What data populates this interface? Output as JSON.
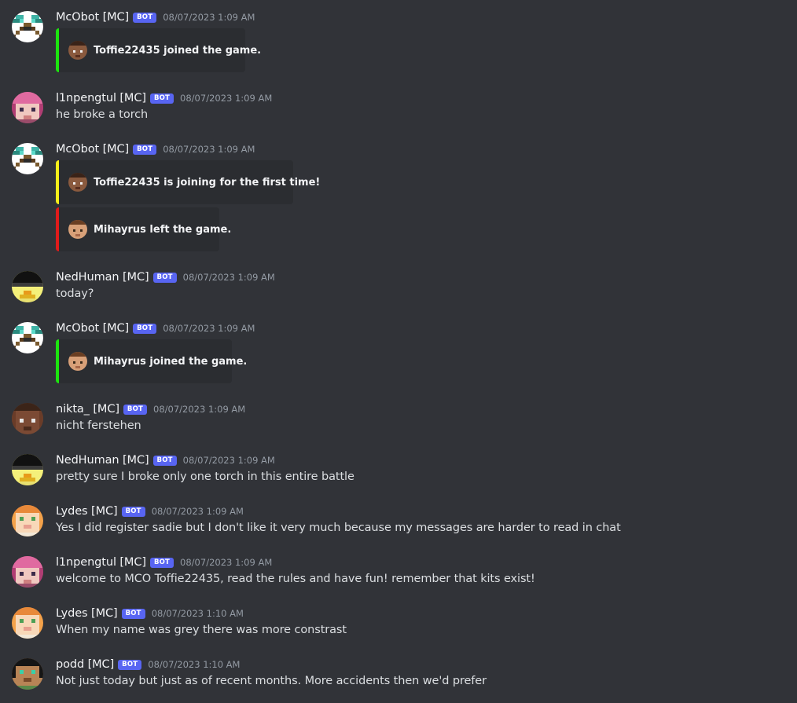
{
  "bot_badge": "BOT",
  "messages": [
    {
      "user": "McObot [MC]",
      "time": "08/07/2023 1:09 AM",
      "avatar": "mcobot-pickaxe-avatar",
      "embeds": [
        {
          "text": "Toffie22435 joined the game.",
          "color": "#1ce40f",
          "icon": "toffie-head"
        }
      ]
    },
    {
      "user": "l1npengtul [MC]",
      "time": "08/07/2023 1:09 AM",
      "avatar": "pink-hair-avatar",
      "text": "he broke a torch"
    },
    {
      "user": "McObot [MC]",
      "time": "08/07/2023 1:09 AM",
      "avatar": "mcobot-pickaxe-avatar",
      "embeds": [
        {
          "text": "Toffie22435 is joining for the first time!",
          "color": "#f6ef1a",
          "icon": "toffie-head"
        },
        {
          "text": "Mihayrus left the game.",
          "color": "#e01b1b",
          "icon": "mihayrus-head"
        }
      ]
    },
    {
      "user": "NedHuman [MC]",
      "time": "08/07/2023 1:09 AM",
      "avatar": "black-hat-duck-avatar",
      "text": "today?"
    },
    {
      "user": "McObot [MC]",
      "time": "08/07/2023 1:09 AM",
      "avatar": "mcobot-pickaxe-avatar",
      "embeds": [
        {
          "text": "Mihayrus joined the game.",
          "color": "#1ce40f",
          "icon": "mihayrus-head"
        }
      ]
    },
    {
      "user": "nikta_ [MC]",
      "time": "08/07/2023 1:09 AM",
      "avatar": "brown-skin-avatar",
      "text": "nicht ferstehen"
    },
    {
      "user": "NedHuman [MC]",
      "time": "08/07/2023 1:09 AM",
      "avatar": "black-hat-duck-avatar",
      "text": "pretty sure I broke only one torch in this entire battle"
    },
    {
      "user": "Lydes [MC]",
      "time": "08/07/2023 1:09 AM",
      "avatar": "orange-hair-avatar",
      "text": "Yes I did register sadie but I don't like it very much because my messages are harder to read in chat"
    },
    {
      "user": "l1npengtul [MC]",
      "time": "08/07/2023 1:09 AM",
      "avatar": "pink-hair-avatar",
      "text": "welcome to MCO Toffie22435, read the rules and have fun! remember that kits exist!"
    },
    {
      "user": "Lydes [MC]",
      "time": "08/07/2023 1:10 AM",
      "avatar": "orange-hair-avatar",
      "text": "When my name was grey there was more constrast"
    },
    {
      "user": "podd [MC]",
      "time": "08/07/2023 1:10 AM",
      "avatar": "black-hair-tan-avatar",
      "text": "Not just today but just as of recent months. More accidents then we'd prefer"
    }
  ]
}
